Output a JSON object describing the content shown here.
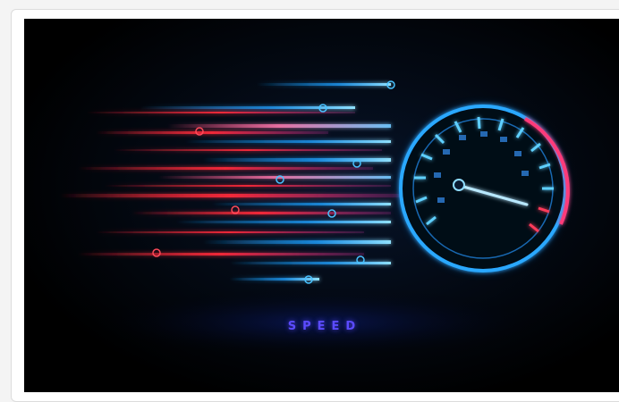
{
  "image": {
    "caption_text": "SPEED",
    "subject": "speedometer-with-motion-trails",
    "colors": {
      "background": "#000000",
      "blue_glow": "#1ea0ff",
      "red_glow": "#ff2a3a",
      "label": "#5b4bff"
    }
  }
}
